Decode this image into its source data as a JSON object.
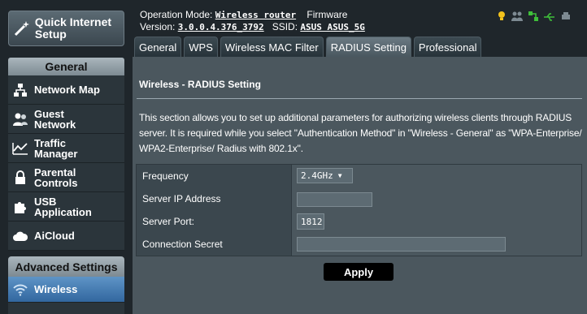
{
  "sidebar": {
    "quick_setup": "Quick Internet Setup",
    "general_header": "General",
    "items": [
      {
        "label": "Network Map",
        "icon": "network-map-icon"
      },
      {
        "label": "Guest Network",
        "icon": "guest-network-icon"
      },
      {
        "label": "Traffic Manager",
        "icon": "traffic-manager-icon"
      },
      {
        "label": "Parental Controls",
        "icon": "lock-icon"
      },
      {
        "label": "USB Application",
        "icon": "puzzle-icon"
      },
      {
        "label": "AiCloud",
        "icon": "cloud-icon"
      }
    ],
    "advanced_header": "Advanced Settings",
    "wireless_label": "Wireless"
  },
  "header": {
    "op_mode_label": "Operation Mode:",
    "op_mode_value": "Wireless router",
    "firmware_label": "Firmware",
    "version_label": "Version:",
    "version_value": "3.0.0.4.376_3792",
    "ssid_label": "SSID:",
    "ssid_value": "ASUS ASUS_5G"
  },
  "tabs": [
    "General",
    "WPS",
    "Wireless MAC Filter",
    "RADIUS Setting",
    "Professional"
  ],
  "active_tab": "RADIUS Setting",
  "page": {
    "title": "Wireless - RADIUS Setting",
    "description": "This section allows you to set up additional parameters for authorizing wireless clients through RADIUS server. It is required while you select \"Authentication Method\" in \"Wireless - General\" as \"WPA-Enterprise/ WPA2-Enterprise/ Radius with 802.1x\"."
  },
  "form": {
    "frequency_label": "Frequency",
    "frequency_value": "2.4GHz",
    "server_ip_label": "Server IP Address",
    "server_ip_value": "",
    "server_port_label": "Server Port:",
    "server_port_value": "1812",
    "secret_label": "Connection Secret",
    "secret_value": ""
  },
  "apply_label": "Apply",
  "colors": {
    "background": "#1f262b",
    "panel": "#4b575e",
    "accent_blue": "#32679f",
    "status_yellow": "#f3c21c",
    "status_green": "#3fbf3a"
  }
}
